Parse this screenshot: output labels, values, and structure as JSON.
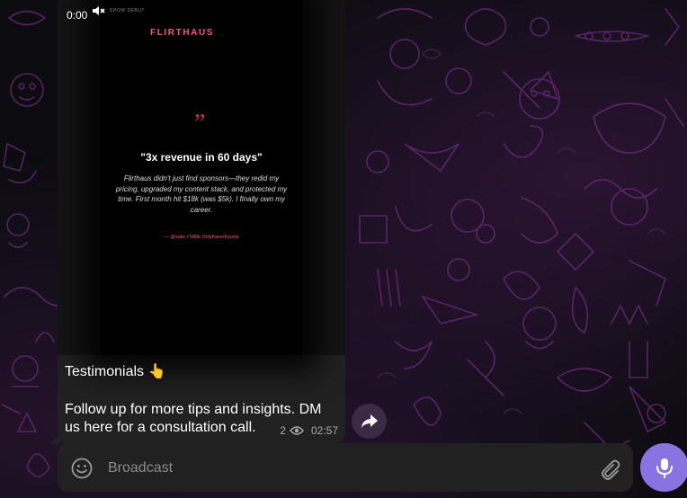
{
  "video": {
    "time": "0:00",
    "mute_icon": "speaker-muted-icon",
    "tiny_label": "SHOW DEBUT",
    "brand": "FLIRTHAUS",
    "quote_mark": "”",
    "headline": "\"3x revenue in 60 days\"",
    "body": "Flirthaus didn't just find sponsors—they redid my pricing, upgraded my content stack, and protected my time. First month hit $18k (was $5k). I finally own my career.",
    "attribution": "— @xalis • 580k OnlyFans/Fansly"
  },
  "caption": {
    "line1": "Testimonials 👆",
    "line2": "Follow up for more tips and insights. DM us here for a consultation call."
  },
  "meta": {
    "views": "2",
    "time": "02:57",
    "eye_icon": "eye-icon"
  },
  "composer": {
    "placeholder": "Broadcast",
    "emoji_icon": "emoji-icon",
    "attach_icon": "paperclip-icon",
    "mic_icon": "microphone-icon",
    "share_icon": "share-icon"
  },
  "colors": {
    "bubble": "#212121",
    "accent": "#8774e1",
    "brand_pink": "#ff4f8b",
    "wallpaper_glow": "#7a2a8c"
  }
}
